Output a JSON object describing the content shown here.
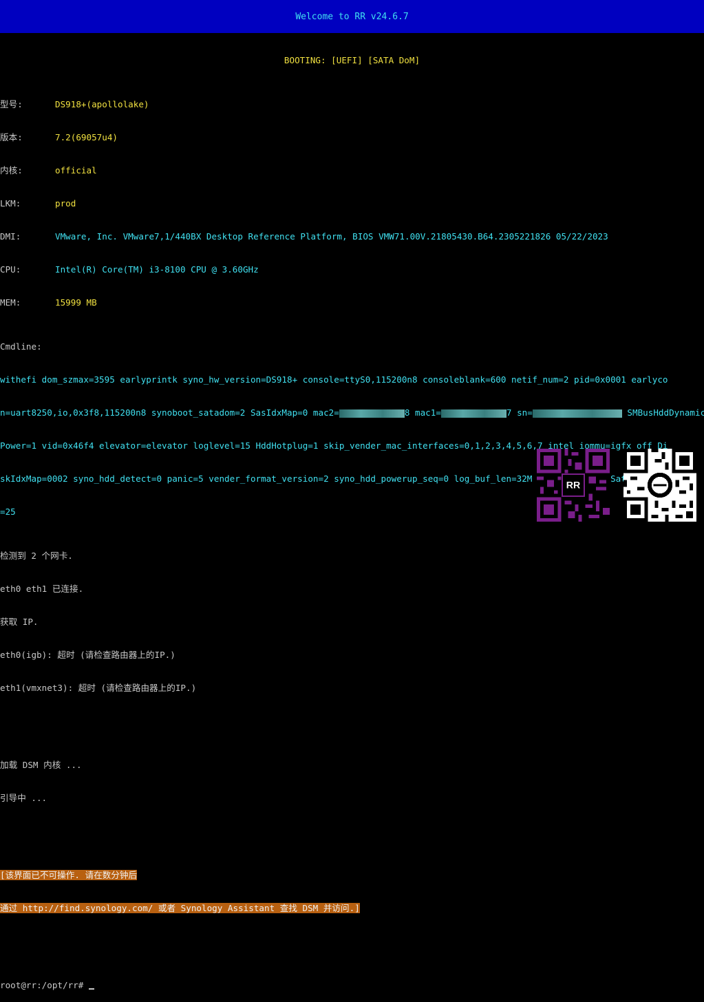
{
  "title": "Welcome to RR v24.6.7",
  "booting": "BOOTING: [UEFI] [SATA DoM]",
  "info": [
    {
      "key": "型号:",
      "value": "DS918+(apollolake)"
    },
    {
      "key": "版本:",
      "value": "7.2(69057u4)"
    },
    {
      "key": "内核:",
      "value": "official"
    },
    {
      "key": "LKM:",
      "value": "prod"
    },
    {
      "key": "DMI:",
      "value": "VMware, Inc. VMware7,1/440BX Desktop Reference Platform, BIOS VMW71.00V.21805430.B64.2305221826 05/22/2023"
    },
    {
      "key": "CPU:",
      "value": "Intel(R) Core(TM) i3-8100 CPU @ 3.60GHz"
    },
    {
      "key": "MEM:",
      "value": "15999 MB"
    }
  ],
  "cmdline_label": "Cmdline:",
  "cmdline": {
    "line1": "withefi dom_szmax=3595 earlyprintk syno_hw_version=DS918+ console=ttyS0,115200n8 consoleblank=600 netif_num=2 pid=0x0001 earlyco",
    "line2a": "n=uart8250,io,0x3f8,115200n8 synoboot_satadom=2 SasIdxMap=0 mac2=",
    "line2b": "8 mac1=",
    "line2c": "7 sn=",
    "line2d": " SMBusHddDynamic",
    "line3": "Power=1 vid=0x46f4 elevator=elevator loglevel=15 HddHotplug=1 skip_vender_mac_interfaces=0,1,2,3,4,5,6,7 intel_iommu=igfx_off Di",
    "line4": "skIdxMap=0002 syno_hdd_detect=0 panic=5 vender_format_version=2 syno_hdd_powerup_seq=0 log_buf_len=32M root=/dev/md0 SataPortMap",
    "line5": "=25"
  },
  "network": [
    "检测到 2 个网卡.",
    "eth0 eth1 已连接.",
    "获取 IP.",
    "eth0(igb): 超时 (请检查路由器上的IP.)",
    "eth1(vmxnet3): 超时 (请检查路由器上的IP.)"
  ],
  "loading": [
    "加载 DSM 内核 ...",
    "引导中 ..."
  ],
  "notice": [
    "[该界面已不可操作. 请在数分钟后",
    "通过 http://find.synology.com/ 或者 Synology Assistant 查找 DSM 并访问.]"
  ],
  "prompt": "root@rr:/opt/rr#",
  "qr_left_logo": "RR",
  "colors": {
    "title_bg": "#0000c0",
    "cyan": "#40e0f0",
    "yellow": "#f0e040",
    "highlight": "#b86010",
    "qr_purple": "#7a1e8a"
  },
  "icons": [
    "qr-code-rr-icon",
    "qr-code-icon"
  ]
}
